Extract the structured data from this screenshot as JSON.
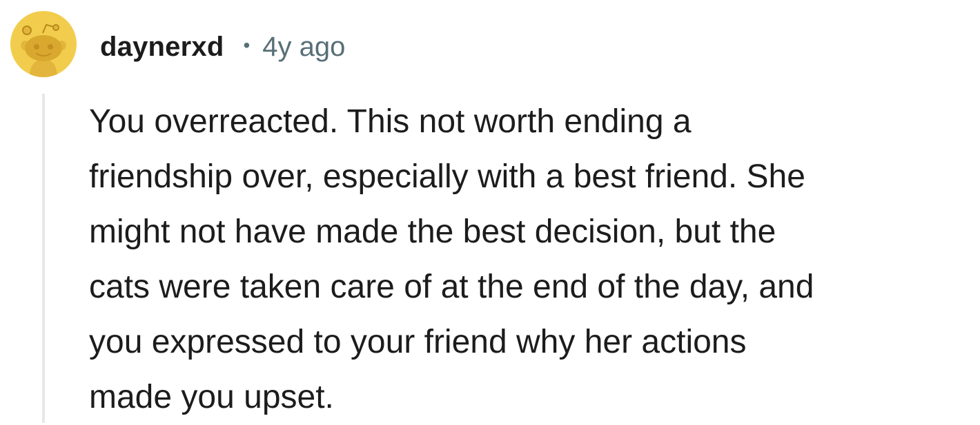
{
  "comment": {
    "username": "daynerxd",
    "separator": "•",
    "timestamp": "4y ago",
    "avatar": {
      "icon": "snoo-avatar-icon",
      "background": "#f2cd4d"
    },
    "body_lines": [
      "You overreacted. This not worth ending a",
      "friendship over, especially with a best friend. She",
      "might not have made the best decision, but the",
      "cats were taken care of at the end of the day, and",
      "you expressed to your friend why her actions",
      "made you upset."
    ]
  },
  "colors": {
    "text": "#1c1c1c",
    "meta_text": "#576f76",
    "thread_line": "#e5e7e8"
  }
}
